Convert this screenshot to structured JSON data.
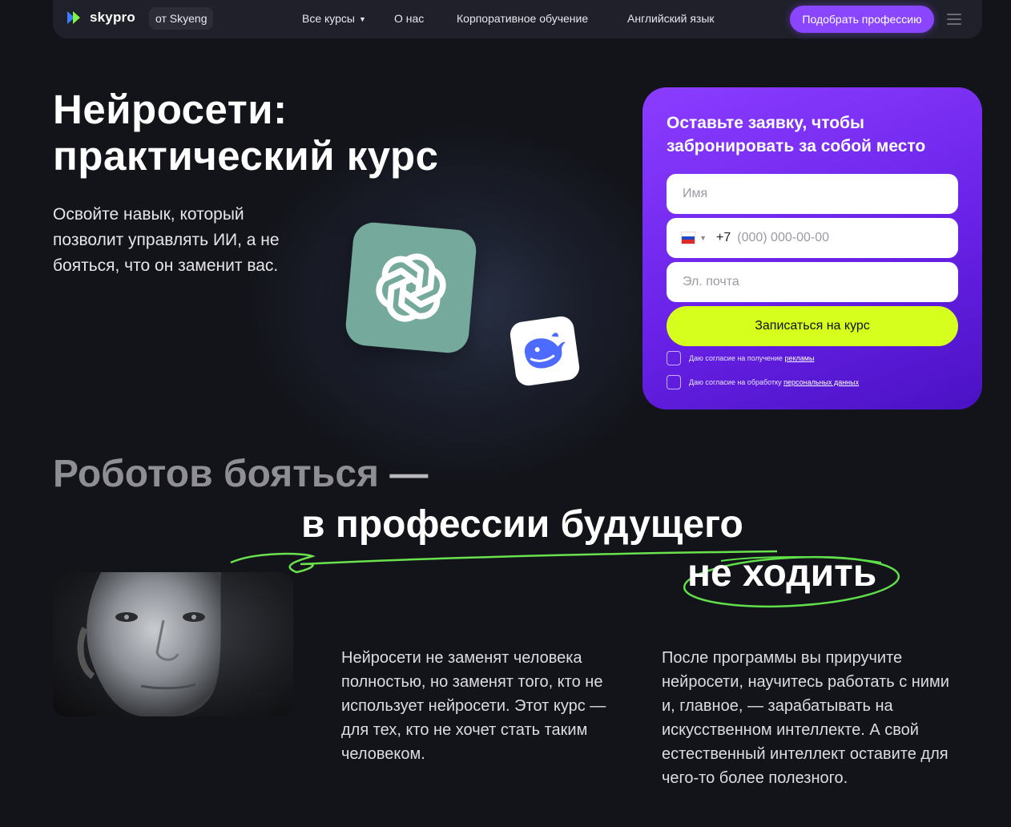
{
  "header": {
    "logo": "skypro",
    "badge": "от Skyeng",
    "nav": [
      "Все курсы",
      "О нас",
      "Корпоративное обучение",
      "Английский язык"
    ],
    "cta": "Подобрать профессию"
  },
  "hero": {
    "title_line1": "Нейросети:",
    "title_line2": "практический курс",
    "subtitle": "Освойте навык, который позволит управлять ИИ, а не бояться, что он заменит вас.",
    "icons": [
      "chatgpt-logo-icon",
      "deepseek-whale-icon"
    ]
  },
  "form": {
    "title": "Оставьте заявку, чтобы забронировать за собой место",
    "name_placeholder": "Имя",
    "phone_code": "+7",
    "phone_placeholder": "(000) 000-00-00",
    "email_placeholder": "Эл. почта",
    "submit": "Записаться на курс",
    "consent_ads_text": "Даю согласие на получение ",
    "consent_ads_link": "рекламы",
    "consent_data_text": "Даю согласие на обработку ",
    "consent_data_link": "персональных данных"
  },
  "section": {
    "heading_part1": "Роботов бояться",
    "heading_dash": "—",
    "heading_part2": "в профессии будущего",
    "heading_part3": "не ходить",
    "text1": "Нейросети не заменят человека полностью, но заменят того, кто не использует нейросети. Этот курс — для тех, кто не хочет стать таким человеком.",
    "text2": "После программы вы приручите нейросети, научитесь работать с ними и, главное, — зарабатывать на искусственном интеллекте. А свой естественный интеллект оставите для чего-то более полезного."
  },
  "colors": {
    "background": "#13141a",
    "accent_purple": "#8a46ff",
    "accent_lime": "#d6ff1e",
    "scribble_green": "#5fe04a",
    "chatgpt_green": "#75a99b"
  }
}
